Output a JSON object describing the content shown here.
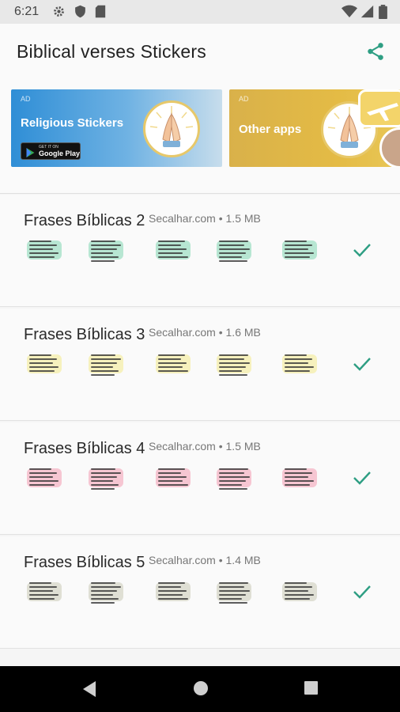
{
  "status": {
    "time": "6:21",
    "left_icons": [
      "gear-icon",
      "shield-icon",
      "sd-card-icon"
    ],
    "right_icons": [
      "wifi-icon",
      "signal-icon",
      "battery-icon"
    ]
  },
  "appbar": {
    "title": "Biblical verses Stickers",
    "action_icon": "share-icon",
    "accent": "#2e9e83"
  },
  "banners": [
    {
      "ad": "AD",
      "title": "Religious Stickers",
      "badge_line1": "GET IT ON",
      "badge_line2": "Google Play"
    },
    {
      "ad": "AD",
      "title": "Other apps"
    }
  ],
  "packs": [
    {
      "name": "Frases Bíblicas 2",
      "author": "Secalhar.com",
      "size": "1.5 MB",
      "installed": true,
      "sticker_tint": "#7fd6b0"
    },
    {
      "name": "Frases Bíblicas 3",
      "author": "Secalhar.com",
      "size": "1.6 MB",
      "installed": true,
      "sticker_tint": "#f3ea8a"
    },
    {
      "name": "Frases Bíblicas 4",
      "author": "Secalhar.com",
      "size": "1.5 MB",
      "installed": true,
      "sticker_tint": "#f29ab0"
    },
    {
      "name": "Frases Bíblicas 5",
      "author": "Secalhar.com",
      "size": "1.4 MB",
      "installed": true,
      "sticker_tint": "#c9c9b4"
    }
  ],
  "meta_separator": "•",
  "navbar": {
    "buttons": [
      "back-icon",
      "home-icon",
      "recents-icon"
    ]
  }
}
